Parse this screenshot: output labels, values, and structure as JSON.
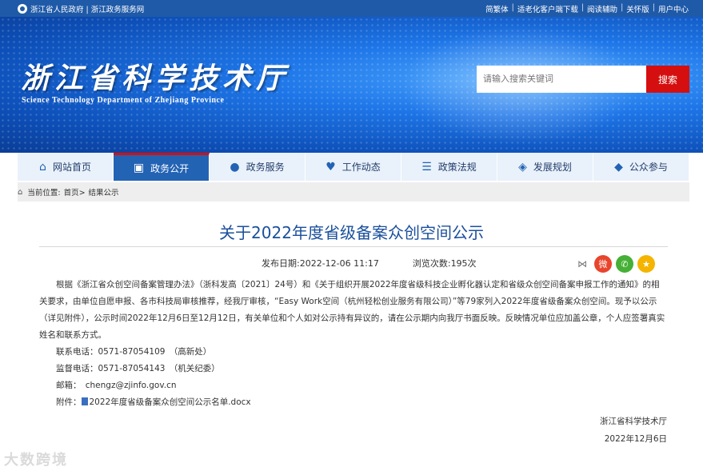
{
  "topbar": {
    "left": "浙江省人民政府 | 浙江政务服务网",
    "right": [
      "简繁体",
      "适老化客户端下载",
      "阅读辅助",
      "关怀版",
      "用户中心"
    ]
  },
  "banner": {
    "title_cn": "浙江省科学技术厅",
    "title_en": "Science Technology Department of Zhejiang Province"
  },
  "search": {
    "placeholder": "请输入搜索关键词",
    "button": "搜索"
  },
  "nav": [
    {
      "label": "网站首页",
      "icon": "home-icon"
    },
    {
      "label": "政务公开",
      "icon": "open-icon",
      "active": true
    },
    {
      "label": "政务服务",
      "icon": "chat-icon"
    },
    {
      "label": "工作动态",
      "icon": "heart-icon"
    },
    {
      "label": "政策法规",
      "icon": "list-icon"
    },
    {
      "label": "发展规划",
      "icon": "handshake-icon"
    },
    {
      "label": "公众参与",
      "icon": "participate-icon"
    }
  ],
  "breadcrumb": {
    "prefix": "当前位置:",
    "home": "首页>",
    "current": "结果公示"
  },
  "article": {
    "title": "关于2022年度省级备案众创空间公示",
    "publish_label": "发布日期:",
    "publish_date": "2022-12-06 11:17",
    "views_label": "浏览次数:",
    "views": "195次",
    "paragraph": "根据《浙江省众创空间备案管理办法》（浙科发高〔2021〕24号）和《关于组织开展2022年度省级科技企业孵化器认定和省级众创空间备案申报工作的通知》的相关要求，由单位自愿申报、各市科技局审核推荐，经我厅审核，“Easy Work空间（杭州轻松创业服务有限公司）”等79家列入2022年度省级备案众创空间。现予以公示（详见附件），公示时间2022年12月6日至12月12日，有关单位和个人如对公示持有异议的，请在公示期内向我厅书面反映。反映情况单位应加盖公章，个人应签署真实姓名和联系方式。",
    "contact": "联系电话：0571-87054109　（高新处）",
    "supervise": "监督电话：0571-87054143　（机关纪委）",
    "email": "邮箱：　chengz@zjinfo.gov.cn",
    "attach_label": "附件：",
    "attach_name": "2022年度省级备案众创空间公示名单.docx",
    "signer": "浙江省科学技术厅",
    "sign_date": "2022年12月6日"
  },
  "watermark": "大数跨境"
}
